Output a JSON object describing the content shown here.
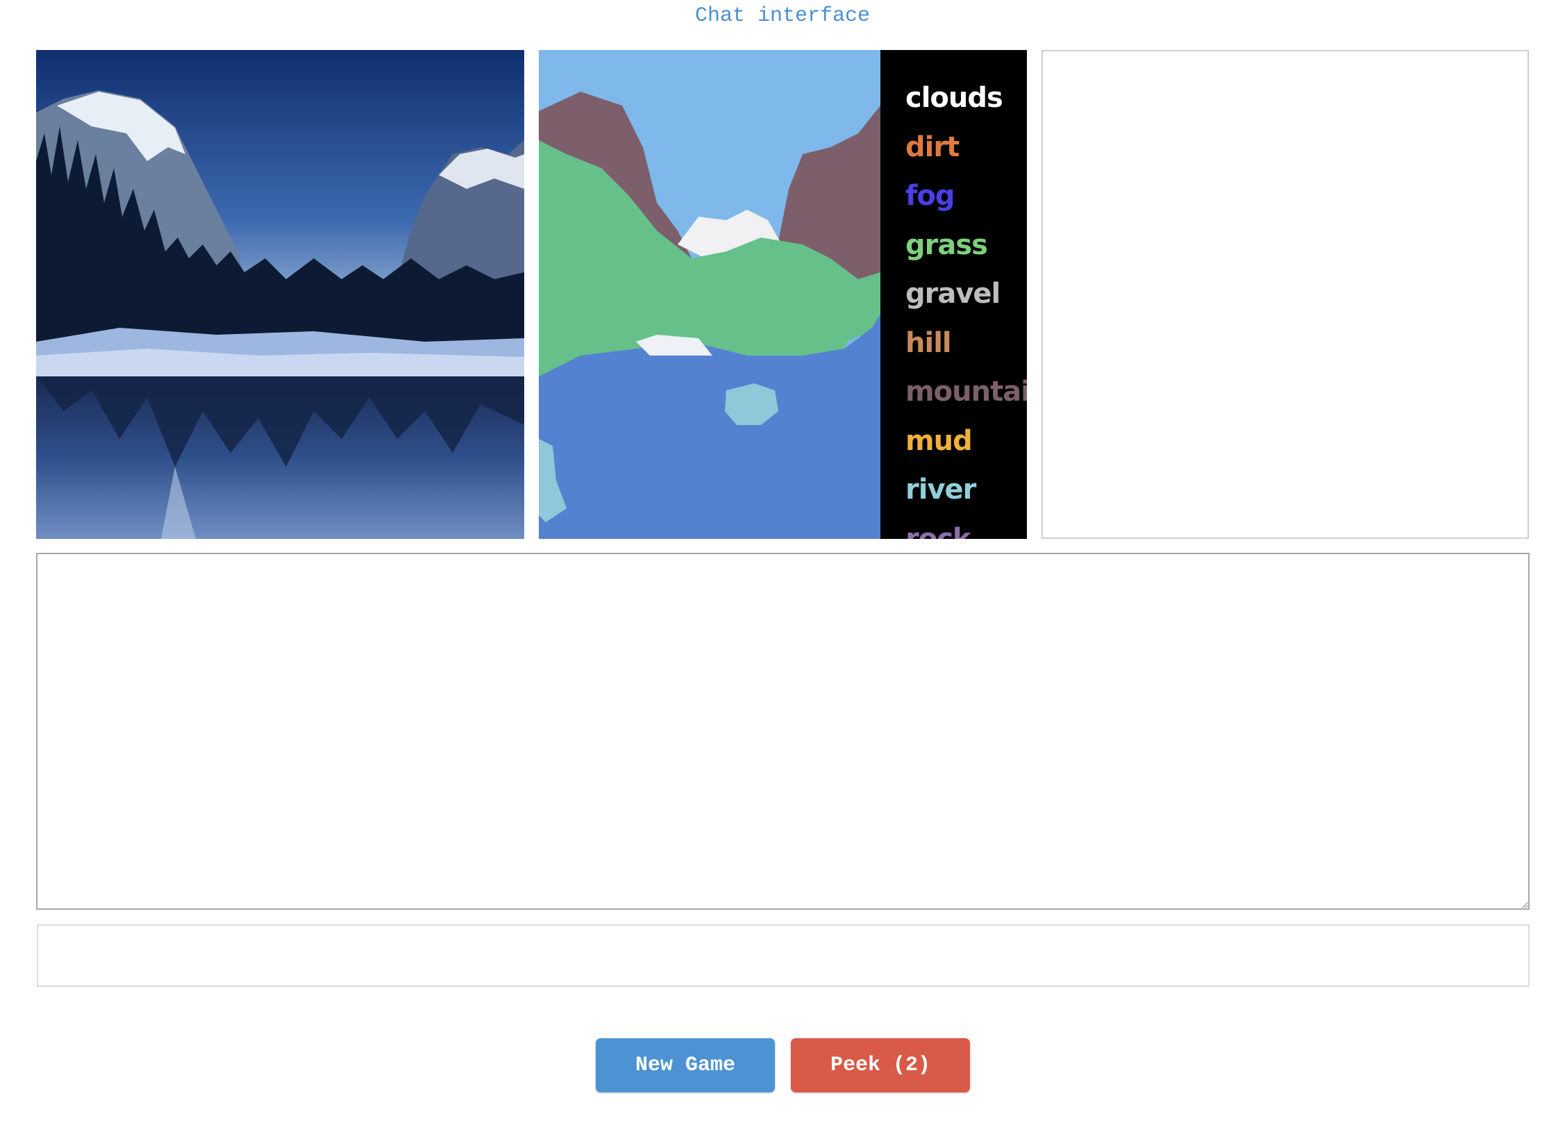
{
  "header": {
    "title": "Chat interface"
  },
  "segmentation": {
    "legend": [
      {
        "label": "clouds",
        "color": "#ffffff"
      },
      {
        "label": "dirt",
        "color": "#e07a3e"
      },
      {
        "label": "fog",
        "color": "#4a3fe6"
      },
      {
        "label": "grass",
        "color": "#7cd07e"
      },
      {
        "label": "gravel",
        "color": "#bdbdbd"
      },
      {
        "label": "hill",
        "color": "#c98a5b"
      },
      {
        "label": "mountain",
        "color": "#7c5f6a"
      },
      {
        "label": "mud",
        "color": "#f0b13a"
      },
      {
        "label": "river",
        "color": "#8fd0d8"
      },
      {
        "label": "rock",
        "color": "#8a6fa8"
      }
    ]
  },
  "chat": {
    "log": ""
  },
  "input": {
    "value": "",
    "placeholder": ""
  },
  "buttons": {
    "new_game": "New Game",
    "peek": "Peek (2)"
  },
  "colors": {
    "accent": "#4a90d2",
    "new_game": "#4d93d3",
    "peek": "#d85a48"
  }
}
